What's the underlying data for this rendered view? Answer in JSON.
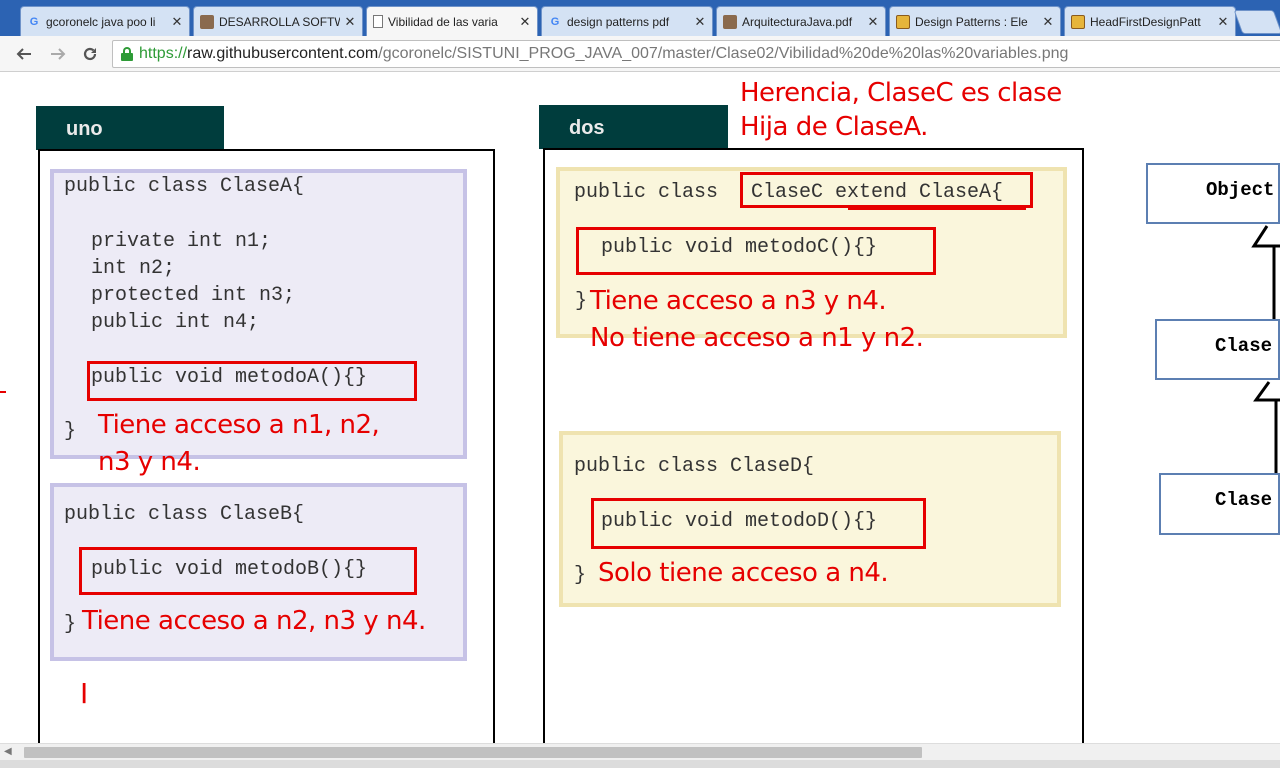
{
  "tabs": [
    {
      "title": "gcoronelc java poo li",
      "icon": "google-icon"
    },
    {
      "title": "DESARROLLA SOFTW",
      "icon": "avatar-icon"
    },
    {
      "title": "Vibilidad de las varia",
      "icon": "document-icon"
    },
    {
      "title": "design patterns pdf",
      "icon": "google-icon"
    },
    {
      "title": "ArquitecturaJava.pdf",
      "icon": "avatar-icon"
    },
    {
      "title": "Design Patterns : Ele",
      "icon": "package-icon"
    },
    {
      "title": "HeadFirstDesignPatt",
      "icon": "package-icon"
    }
  ],
  "tab_close_glyph": "✕",
  "address": {
    "scheme": "https://",
    "host": "raw.githubusercontent.com",
    "path": "/gcoronelc/SISTUNI_PROG_JAVA_007/master/Clase02/Vibilidad%20de%20las%20variables.png"
  },
  "image": {
    "panels": [
      {
        "label": "uno"
      },
      {
        "label": "dos"
      }
    ],
    "clase_a": {
      "header": "public class ClaseA{",
      "fields": [
        "private int n1;",
        "int n2;",
        "protected int n3;",
        "public int n4;"
      ],
      "method": "public void metodoA(){}",
      "close": "}",
      "note_line1": "Tiene acceso a n1, n2,",
      "note_line2": "n3 y n4."
    },
    "clase_b": {
      "header": "public class ClaseB{",
      "method": "public void metodoB(){}",
      "close": "}",
      "note": "Tiene acceso a n2, n3 y n4."
    },
    "clase_c": {
      "header_prefix": "public class ",
      "header_decl": "ClaseC extend ClaseA{",
      "method": "public void metodoC(){}",
      "close": "}",
      "note_line1": "Tiene acceso a n3 y n4.",
      "note_line2": "No tiene acceso a n1 y n2."
    },
    "clase_d": {
      "header": "public class ClaseD{",
      "method": "public void metodoD(){}",
      "close": "}",
      "note": "Solo tiene acceso a n4."
    },
    "herencia_note_line1": "Herencia, ClaseC es clase",
    "herencia_note_line2": "Hija de ClaseA.",
    "stray_mark": "I",
    "uml": [
      "Object",
      "Clase",
      "Clase"
    ]
  },
  "colors": {
    "annotation_red": "#e60000",
    "panel_header": "#003d3d",
    "purple_box": "#c6c2e6",
    "yellow_box": "#efe3b0",
    "tab_strip": "#2c63b3"
  }
}
